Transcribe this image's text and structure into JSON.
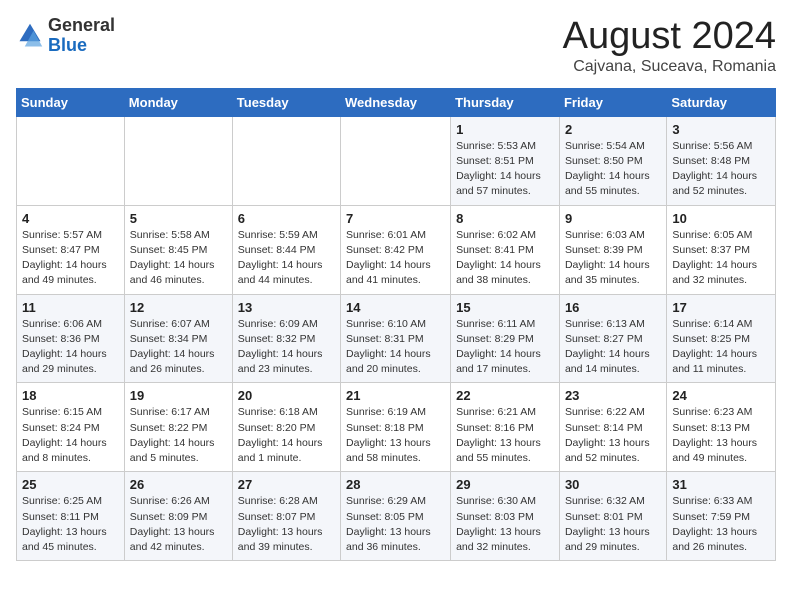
{
  "logo": {
    "general": "General",
    "blue": "Blue"
  },
  "header": {
    "month": "August 2024",
    "location": "Cajvana, Suceava, Romania"
  },
  "weekdays": [
    "Sunday",
    "Monday",
    "Tuesday",
    "Wednesday",
    "Thursday",
    "Friday",
    "Saturday"
  ],
  "weeks": [
    [
      {
        "day": "",
        "info": ""
      },
      {
        "day": "",
        "info": ""
      },
      {
        "day": "",
        "info": ""
      },
      {
        "day": "",
        "info": ""
      },
      {
        "day": "1",
        "info": "Sunrise: 5:53 AM\nSunset: 8:51 PM\nDaylight: 14 hours\nand 57 minutes."
      },
      {
        "day": "2",
        "info": "Sunrise: 5:54 AM\nSunset: 8:50 PM\nDaylight: 14 hours\nand 55 minutes."
      },
      {
        "day": "3",
        "info": "Sunrise: 5:56 AM\nSunset: 8:48 PM\nDaylight: 14 hours\nand 52 minutes."
      }
    ],
    [
      {
        "day": "4",
        "info": "Sunrise: 5:57 AM\nSunset: 8:47 PM\nDaylight: 14 hours\nand 49 minutes."
      },
      {
        "day": "5",
        "info": "Sunrise: 5:58 AM\nSunset: 8:45 PM\nDaylight: 14 hours\nand 46 minutes."
      },
      {
        "day": "6",
        "info": "Sunrise: 5:59 AM\nSunset: 8:44 PM\nDaylight: 14 hours\nand 44 minutes."
      },
      {
        "day": "7",
        "info": "Sunrise: 6:01 AM\nSunset: 8:42 PM\nDaylight: 14 hours\nand 41 minutes."
      },
      {
        "day": "8",
        "info": "Sunrise: 6:02 AM\nSunset: 8:41 PM\nDaylight: 14 hours\nand 38 minutes."
      },
      {
        "day": "9",
        "info": "Sunrise: 6:03 AM\nSunset: 8:39 PM\nDaylight: 14 hours\nand 35 minutes."
      },
      {
        "day": "10",
        "info": "Sunrise: 6:05 AM\nSunset: 8:37 PM\nDaylight: 14 hours\nand 32 minutes."
      }
    ],
    [
      {
        "day": "11",
        "info": "Sunrise: 6:06 AM\nSunset: 8:36 PM\nDaylight: 14 hours\nand 29 minutes."
      },
      {
        "day": "12",
        "info": "Sunrise: 6:07 AM\nSunset: 8:34 PM\nDaylight: 14 hours\nand 26 minutes."
      },
      {
        "day": "13",
        "info": "Sunrise: 6:09 AM\nSunset: 8:32 PM\nDaylight: 14 hours\nand 23 minutes."
      },
      {
        "day": "14",
        "info": "Sunrise: 6:10 AM\nSunset: 8:31 PM\nDaylight: 14 hours\nand 20 minutes."
      },
      {
        "day": "15",
        "info": "Sunrise: 6:11 AM\nSunset: 8:29 PM\nDaylight: 14 hours\nand 17 minutes."
      },
      {
        "day": "16",
        "info": "Sunrise: 6:13 AM\nSunset: 8:27 PM\nDaylight: 14 hours\nand 14 minutes."
      },
      {
        "day": "17",
        "info": "Sunrise: 6:14 AM\nSunset: 8:25 PM\nDaylight: 14 hours\nand 11 minutes."
      }
    ],
    [
      {
        "day": "18",
        "info": "Sunrise: 6:15 AM\nSunset: 8:24 PM\nDaylight: 14 hours\nand 8 minutes."
      },
      {
        "day": "19",
        "info": "Sunrise: 6:17 AM\nSunset: 8:22 PM\nDaylight: 14 hours\nand 5 minutes."
      },
      {
        "day": "20",
        "info": "Sunrise: 6:18 AM\nSunset: 8:20 PM\nDaylight: 14 hours\nand 1 minute."
      },
      {
        "day": "21",
        "info": "Sunrise: 6:19 AM\nSunset: 8:18 PM\nDaylight: 13 hours\nand 58 minutes."
      },
      {
        "day": "22",
        "info": "Sunrise: 6:21 AM\nSunset: 8:16 PM\nDaylight: 13 hours\nand 55 minutes."
      },
      {
        "day": "23",
        "info": "Sunrise: 6:22 AM\nSunset: 8:14 PM\nDaylight: 13 hours\nand 52 minutes."
      },
      {
        "day": "24",
        "info": "Sunrise: 6:23 AM\nSunset: 8:13 PM\nDaylight: 13 hours\nand 49 minutes."
      }
    ],
    [
      {
        "day": "25",
        "info": "Sunrise: 6:25 AM\nSunset: 8:11 PM\nDaylight: 13 hours\nand 45 minutes."
      },
      {
        "day": "26",
        "info": "Sunrise: 6:26 AM\nSunset: 8:09 PM\nDaylight: 13 hours\nand 42 minutes."
      },
      {
        "day": "27",
        "info": "Sunrise: 6:28 AM\nSunset: 8:07 PM\nDaylight: 13 hours\nand 39 minutes."
      },
      {
        "day": "28",
        "info": "Sunrise: 6:29 AM\nSunset: 8:05 PM\nDaylight: 13 hours\nand 36 minutes."
      },
      {
        "day": "29",
        "info": "Sunrise: 6:30 AM\nSunset: 8:03 PM\nDaylight: 13 hours\nand 32 minutes."
      },
      {
        "day": "30",
        "info": "Sunrise: 6:32 AM\nSunset: 8:01 PM\nDaylight: 13 hours\nand 29 minutes."
      },
      {
        "day": "31",
        "info": "Sunrise: 6:33 AM\nSunset: 7:59 PM\nDaylight: 13 hours\nand 26 minutes."
      }
    ]
  ]
}
